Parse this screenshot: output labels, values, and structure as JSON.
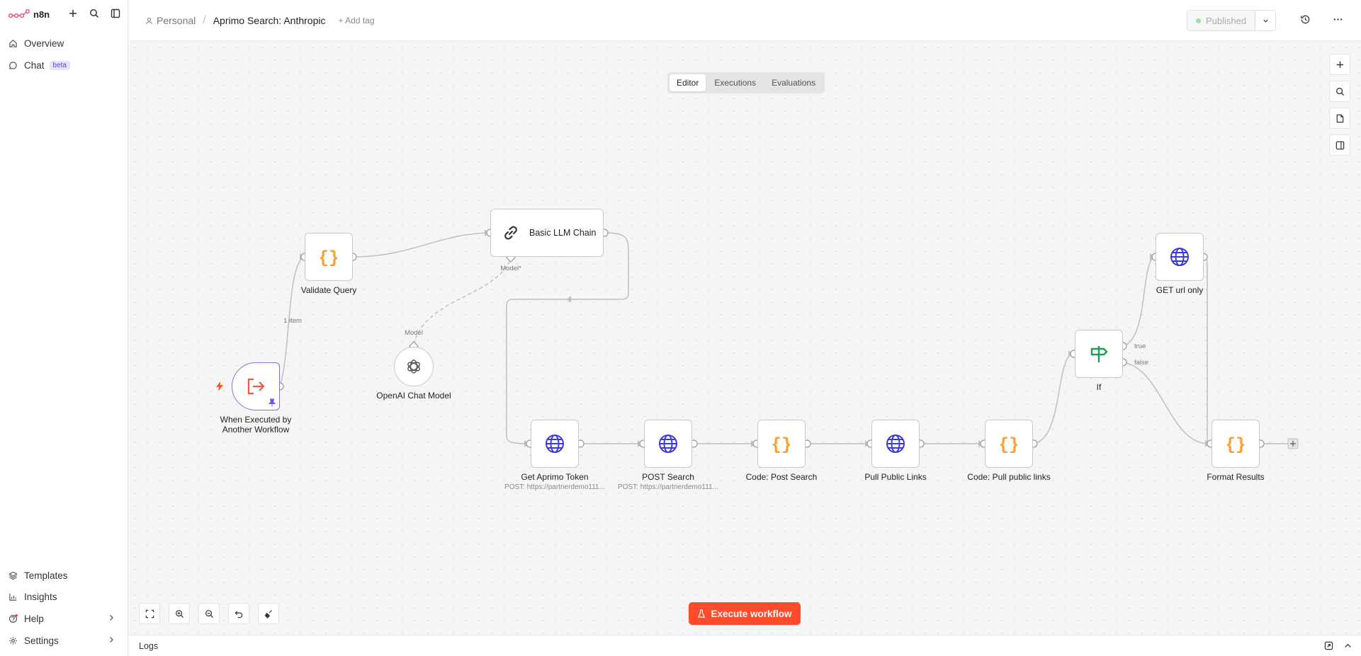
{
  "sidebar": {
    "logo_text": "n8n",
    "items_top": [
      {
        "label": "Overview",
        "icon": "home-icon"
      },
      {
        "label": "Chat",
        "icon": "chat-icon",
        "badge": "beta"
      }
    ],
    "items_bottom": [
      {
        "label": "Templates",
        "icon": "templates-icon"
      },
      {
        "label": "Insights",
        "icon": "insights-icon"
      },
      {
        "label": "Help",
        "icon": "help-icon"
      },
      {
        "label": "Settings",
        "icon": "gear-icon"
      }
    ]
  },
  "header": {
    "project": "Personal",
    "workflow_name": "Aprimo Search: Anthropic",
    "add_tag": "+ Add tag",
    "publish_label": "Published"
  },
  "canvas": {
    "tabs": [
      "Editor",
      "Executions",
      "Evaluations"
    ],
    "active_tab": "Editor",
    "execute_label": "Execute workflow"
  },
  "nodes": {
    "trigger": "When Executed by Another Workflow",
    "trigger_line1": "When Executed by",
    "trigger_line2": "Another Workflow",
    "validate": "Validate Query",
    "llm": "Basic LLM Chain",
    "llm_port": "Model*",
    "openai": "OpenAI Chat Model",
    "openai_port": "Model",
    "token": "Get Aprimo Token",
    "token_sub": "POST: https://partnerdemo111...",
    "post_search": "POST Search",
    "post_search_sub": "POST: https://partnerdemo111...",
    "code_post": "Code: Post Search",
    "pull_links": "Pull Public Links",
    "code_pull": "Code: Pull public links",
    "if": "If",
    "if_true": "true",
    "if_false": "false",
    "get_url": "GET url only",
    "format": "Format Results",
    "edge_label": "1 item"
  },
  "colors": {
    "accent": "#ff4b2b",
    "code": "#ff9b26",
    "http": "#3b3ad3",
    "if": "#1e9a5a",
    "trigger": "#ee5a3a"
  },
  "logs": {
    "label": "Logs"
  }
}
